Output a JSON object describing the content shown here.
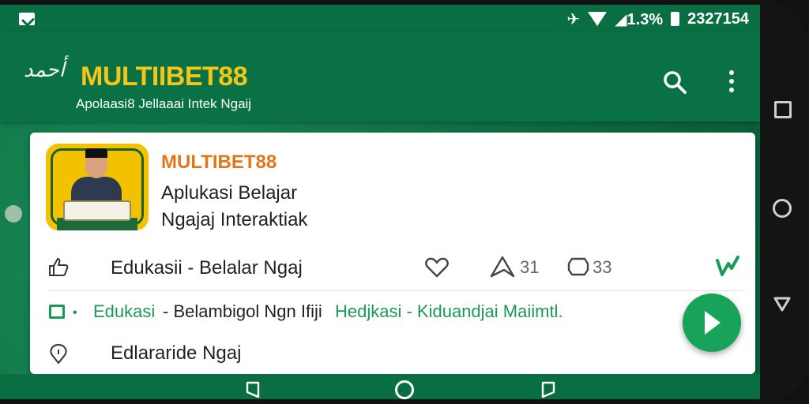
{
  "status_bar": {
    "indicators": "ⴲ ▾ ◢ 1.3% ▮",
    "signal_text": "◢1.3%",
    "time": "2327154"
  },
  "app_bar": {
    "logo_script": "ﺃﺣﻤﺪ",
    "brand": "MULTIIBET88",
    "subtitle": "Apolaasi8 Jellaaai Intek Ngaij",
    "search_icon": "search-icon",
    "more_icon": "more-vert-icon"
  },
  "card": {
    "brand": "MULTIBET88",
    "title_line1": "Aplukasi Belajar",
    "title_line2": "Ngajaj Interaktiak",
    "actions_row": {
      "label": "Edukasii  -  Belalar Ngaj",
      "share_count": "31",
      "comment_count": "33"
    },
    "info_row": {
      "marker": "•",
      "green_text": "Edukasi",
      "dark_text": "- Belambigol Ngn Ifiji",
      "green_text_2": "Hedjkasi  - Kiduandjai Maiimtl."
    },
    "bottom_row": {
      "label": "Edlararide Ngaj"
    }
  },
  "colors": {
    "primary": "#0a7145",
    "accent": "#f5c518",
    "brand_orange": "#e0761a",
    "green_text": "#1a9a55",
    "fab": "#18a35a"
  }
}
